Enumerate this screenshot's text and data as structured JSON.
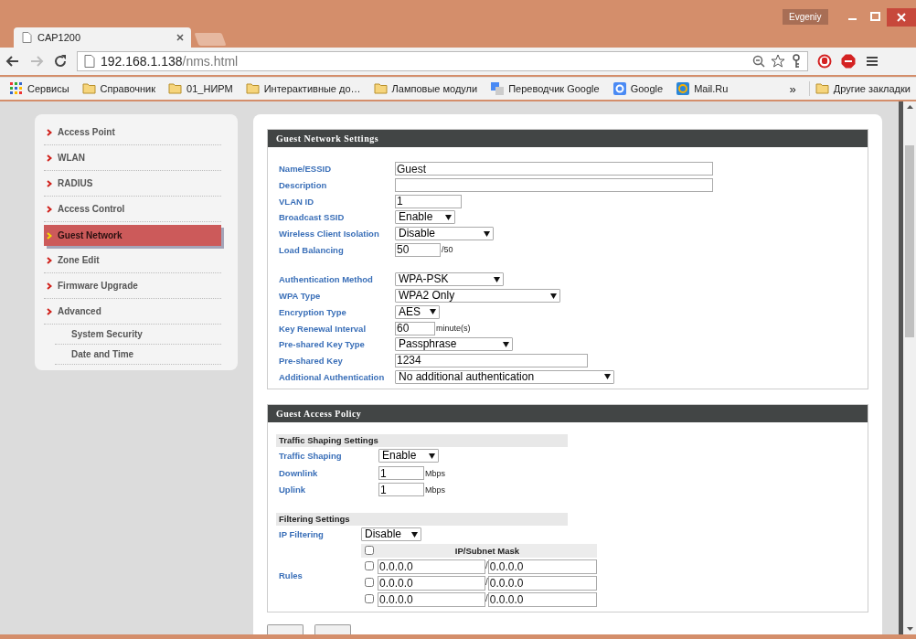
{
  "window": {
    "tab_title": "CAP1200",
    "profile": "Evgeniy"
  },
  "address_bar": {
    "host": "192.168.1.138",
    "path": "/nms.html"
  },
  "bookmarks": [
    {
      "kind": "apps",
      "label": "Сервисы"
    },
    {
      "kind": "folder",
      "label": "Справочник"
    },
    {
      "kind": "folder",
      "label": "01_НИРМ"
    },
    {
      "kind": "folder",
      "label": "Интерактивные до…"
    },
    {
      "kind": "folder",
      "label": "Ламповые модули"
    },
    {
      "kind": "translate",
      "label": "Переводчик Google"
    },
    {
      "kind": "google",
      "label": "Google"
    },
    {
      "kind": "mail",
      "label": "Mail.Ru"
    }
  ],
  "bookmarks_overflow": "»",
  "other_bookmarks": "Другие закладки",
  "sidebar": {
    "items": [
      {
        "label": "Access Point",
        "selected": false
      },
      {
        "label": "WLAN",
        "selected": false
      },
      {
        "label": "RADIUS",
        "selected": false
      },
      {
        "label": "Access Control",
        "selected": false
      },
      {
        "label": "Guest Network",
        "selected": true
      },
      {
        "label": "Zone Edit",
        "selected": false
      },
      {
        "label": "Firmware Upgrade",
        "selected": false
      },
      {
        "label": "Advanced",
        "selected": false,
        "children": [
          {
            "label": "System Security",
            "selected": false
          },
          {
            "label": "Date and Time",
            "selected": false
          }
        ]
      }
    ]
  },
  "guest_network_settings": {
    "title": "Guest Network Settings",
    "groups": [
      [
        {
          "label": "Name/ESSID",
          "kind": "text",
          "value": "Guest"
        },
        {
          "label": "Description",
          "kind": "text"
        },
        {
          "label": "VLAN ID",
          "kind": "text",
          "value": "1"
        },
        {
          "label": "Broadcast SSID",
          "kind": "select",
          "value": "Enable"
        },
        {
          "label": "Wireless Client Isolation",
          "kind": "select",
          "value": "Disable"
        },
        {
          "label": "Load Balancing",
          "kind": "text",
          "value": "50",
          "suffix": "/50"
        }
      ],
      [
        {
          "label": "Authentication Method",
          "kind": "select",
          "value": "WPA-PSK"
        },
        {
          "label": "WPA Type",
          "kind": "select",
          "value": "WPA2 Only"
        },
        {
          "label": "Encryption Type",
          "kind": "select",
          "value": "AES"
        },
        {
          "label": "Key Renewal Interval",
          "kind": "text",
          "value": "60",
          "suffix": "minute(s)"
        },
        {
          "label": "Pre-shared Key Type",
          "kind": "select",
          "value": "Passphrase"
        },
        {
          "label": "Pre-shared Key",
          "kind": "text",
          "value": "1234"
        },
        {
          "label": "Additional Authentication",
          "kind": "select",
          "value": "No additional authentication"
        }
      ]
    ]
  },
  "guest_access_policy": {
    "title": "Guest Access Policy",
    "traffic_shaping": {
      "title": "Traffic Shaping Settings",
      "fields": [
        {
          "label": "Traffic Shaping",
          "kind": "select",
          "value": "Enable"
        },
        {
          "label": "Downlink",
          "kind": "text",
          "value": "1",
          "suffix": "Mbps"
        },
        {
          "label": "Uplink",
          "kind": "text",
          "value": "1",
          "suffix": "Mbps"
        }
      ]
    },
    "filtering": {
      "title": "Filtering Settings",
      "ip_filtering": {
        "label": "IP Filtering",
        "kind": "select",
        "value": "Disable"
      },
      "rules": {
        "label": "Rules",
        "header": "IP/Subnet Mask",
        "all_checked": false,
        "separator": "/",
        "rows": [
          {
            "checked": false,
            "ip": "0.0.0.0",
            "mask": "0.0.0.0"
          },
          {
            "checked": false,
            "ip": "0.0.0.0",
            "mask": "0.0.0.0"
          },
          {
            "checked": false,
            "ip": "0.0.0.0",
            "mask": "0.0.0.0"
          }
        ]
      }
    }
  }
}
